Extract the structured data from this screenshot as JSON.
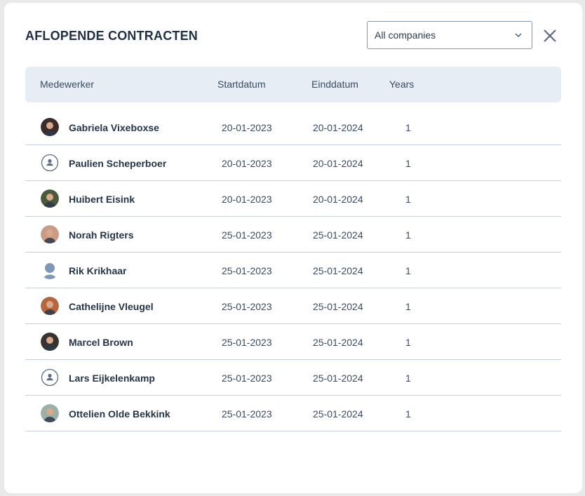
{
  "header": {
    "title": "AFLOPENDE CONTRACTEN",
    "company_filter": "All companies",
    "close_icon": "close-icon"
  },
  "table": {
    "columns": [
      "Medewerker",
      "Startdatum",
      "Einddatum",
      "Years"
    ],
    "rows": [
      {
        "name": "Gabriela Vixeboxse",
        "start": "20-01-2023",
        "end": "20-01-2024",
        "years": "1",
        "avatar": "photo",
        "color": "#3b2b2a"
      },
      {
        "name": "Paulien Scheperboer",
        "start": "20-01-2023",
        "end": "20-01-2024",
        "years": "1",
        "avatar": "placeholder-outline",
        "color": "#5c6b80"
      },
      {
        "name": "Huibert Eisink",
        "start": "20-01-2023",
        "end": "20-01-2024",
        "years": "1",
        "avatar": "photo",
        "color": "#4a5a3a"
      },
      {
        "name": "Norah Rigters",
        "start": "25-01-2023",
        "end": "25-01-2024",
        "years": "1",
        "avatar": "photo",
        "color": "#c99a84"
      },
      {
        "name": "Rik Krikhaar",
        "start": "25-01-2023",
        "end": "25-01-2024",
        "years": "1",
        "avatar": "placeholder-filled",
        "color": "#7f98b8"
      },
      {
        "name": "Cathelijne Vleugel",
        "start": "25-01-2023",
        "end": "25-01-2024",
        "years": "1",
        "avatar": "photo",
        "color": "#b5663e"
      },
      {
        "name": "Marcel Brown",
        "start": "25-01-2023",
        "end": "25-01-2024",
        "years": "1",
        "avatar": "photo",
        "color": "#3a3230"
      },
      {
        "name": "Lars Eijkelenkamp",
        "start": "25-01-2023",
        "end": "25-01-2024",
        "years": "1",
        "avatar": "placeholder-outline",
        "color": "#5c6b80"
      },
      {
        "name": "Ottelien Olde Bekkink",
        "start": "25-01-2023",
        "end": "25-01-2024",
        "years": "1",
        "avatar": "photo",
        "color": "#9ab0a8"
      }
    ]
  },
  "colors": {
    "header_bg": "#e6edf5",
    "divider": "#c6ced8",
    "text": "#2b3a4f"
  }
}
